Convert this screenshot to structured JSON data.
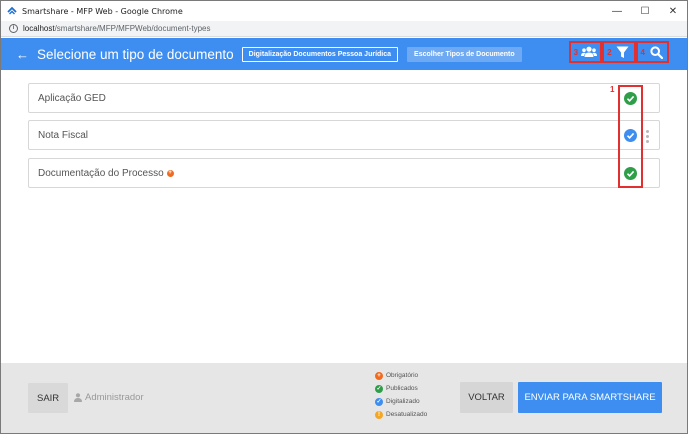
{
  "browser": {
    "window_title": "Smartshare - MFP Web - Google Chrome",
    "url_host": "localhost",
    "url_path": "/smartshare/MFP/MFPWeb/document-types",
    "controls": {
      "minimize": "—",
      "maximize": "☐",
      "close": "✕"
    }
  },
  "header": {
    "title": "Selecione um tipo de documento",
    "chip_active": "Digitalização Documentos Pessoa Jurídica",
    "chip_inactive": "Escolher Tipos de Documento",
    "annotations": {
      "users": "3",
      "filter": "2",
      "search": "4",
      "status_column": "1"
    }
  },
  "documents": [
    {
      "label": "Aplicação GED",
      "status": "publicado",
      "required": false,
      "menu": false
    },
    {
      "label": "Nota Fiscal",
      "status": "digitalizado",
      "required": false,
      "menu": true
    },
    {
      "label": "Documentação do Processo",
      "status": "publicado",
      "required": true,
      "menu": false
    }
  ],
  "footer": {
    "sair_label": "SAIR",
    "user_name": "Administrador",
    "legend": [
      {
        "label": "Obrigatório",
        "color": "#f06a1f",
        "glyph": "+"
      },
      {
        "label": "Publicados",
        "color": "#2e9e49",
        "glyph": "✓"
      },
      {
        "label": "Digitalizado",
        "color": "#3d8ef0",
        "glyph": "✓"
      },
      {
        "label": "Desatualizado",
        "color": "#f5a623",
        "glyph": "!"
      }
    ],
    "voltar_label": "VOLTAR",
    "enviar_label": "ENVIAR PARA SMARTSHARE"
  },
  "colors": {
    "primary": "#3d8ef0",
    "publicado": "#2e9e49",
    "digitalizado": "#3d8ef0",
    "obrigatorio": "#f06a1f",
    "annotation": "#e03030"
  }
}
